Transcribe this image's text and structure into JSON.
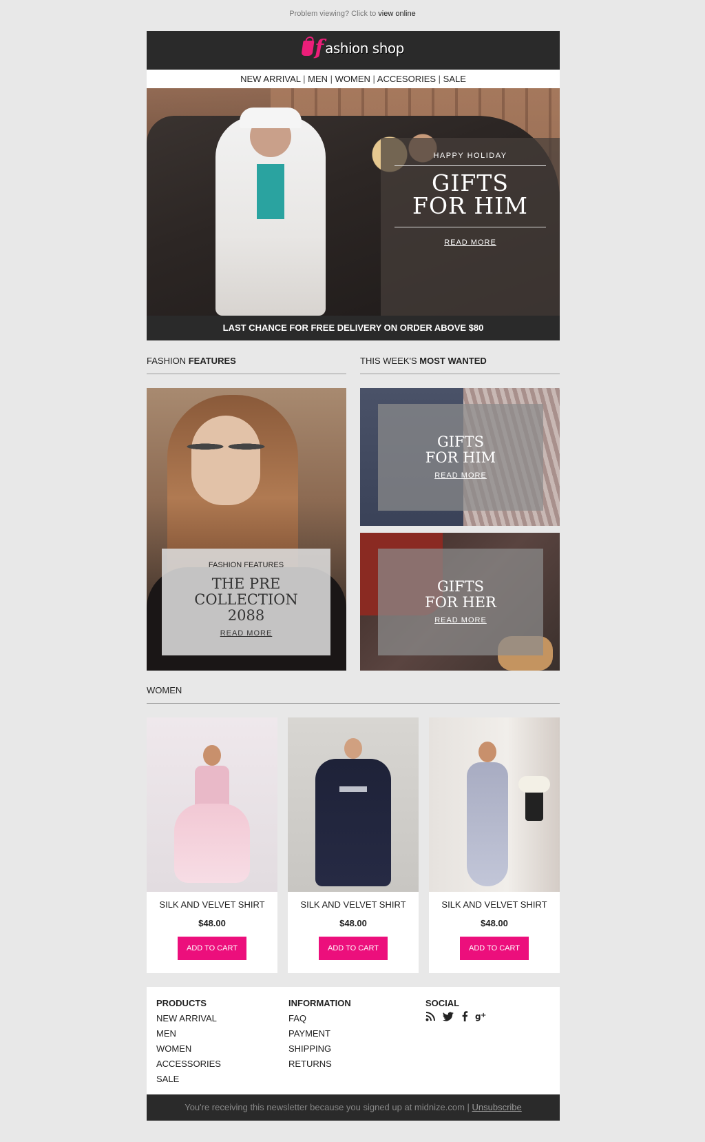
{
  "preheader": {
    "text": "Problem viewing? Click to",
    "link": "view online"
  },
  "logo": {
    "letter": "f",
    "text": "ashion shop"
  },
  "nav": [
    "NEW ARRIVAL",
    "MEN",
    "WOMEN",
    "ACCESORIES",
    "SALE"
  ],
  "hero": {
    "kicker": "HAPPY HOLIDAY",
    "title_line1": "GIFTS",
    "title_line2": "FOR HIM",
    "read_more": "READ MORE"
  },
  "promo": "LAST CHANCE FOR FREE DELIVERY ON ORDER ABOVE $80",
  "sections": {
    "features": {
      "label": "FASHION",
      "bold": "FEATURES"
    },
    "most_wanted": {
      "label": "THIS WEEK'S",
      "bold": "MOST WANTED"
    },
    "women": {
      "label": "WOMEN"
    }
  },
  "feature_card": {
    "kicker": "FASHION FEATURES",
    "title_line1": "THE PRE",
    "title_line2": "COLLECTION",
    "title_line3": "2088",
    "read_more": "READ MORE"
  },
  "most_wanted": [
    {
      "line1": "GIFTS",
      "line2": "FOR HIM",
      "read_more": "READ MORE"
    },
    {
      "line1": "GIFTS",
      "line2": "FOR HER",
      "read_more": "READ MORE"
    }
  ],
  "products": [
    {
      "name": "SILK AND VELVET SHIRT",
      "price": "$48.00",
      "button": "ADD TO CART"
    },
    {
      "name": "SILK AND VELVET SHIRT",
      "price": "$48.00",
      "button": "ADD TO CART"
    },
    {
      "name": "SILK AND VELVET SHIRT",
      "price": "$48.00",
      "button": "ADD TO CART"
    }
  ],
  "footer": {
    "products": {
      "heading": "PRODUCTS",
      "items": [
        "NEW ARRIVAL",
        "MEN",
        "WOMEN",
        "ACCESSORIES",
        "SALE"
      ]
    },
    "information": {
      "heading": "INFORMATION",
      "items": [
        "FAQ",
        "PAYMENT",
        "SHIPPING",
        "RETURNS"
      ]
    },
    "social": {
      "heading": "SOCIAL",
      "icons": [
        "rss-icon",
        "twitter-icon",
        "facebook-icon",
        "google-plus-icon"
      ]
    }
  },
  "bottom": {
    "text": "You're receiving this newsletter because you signed up at midnize.com |",
    "unsubscribe": "Unsubscribe"
  },
  "colors": {
    "accent": "#ec0f7c",
    "dark": "#2a2a2a",
    "background": "#e8e8e8"
  }
}
